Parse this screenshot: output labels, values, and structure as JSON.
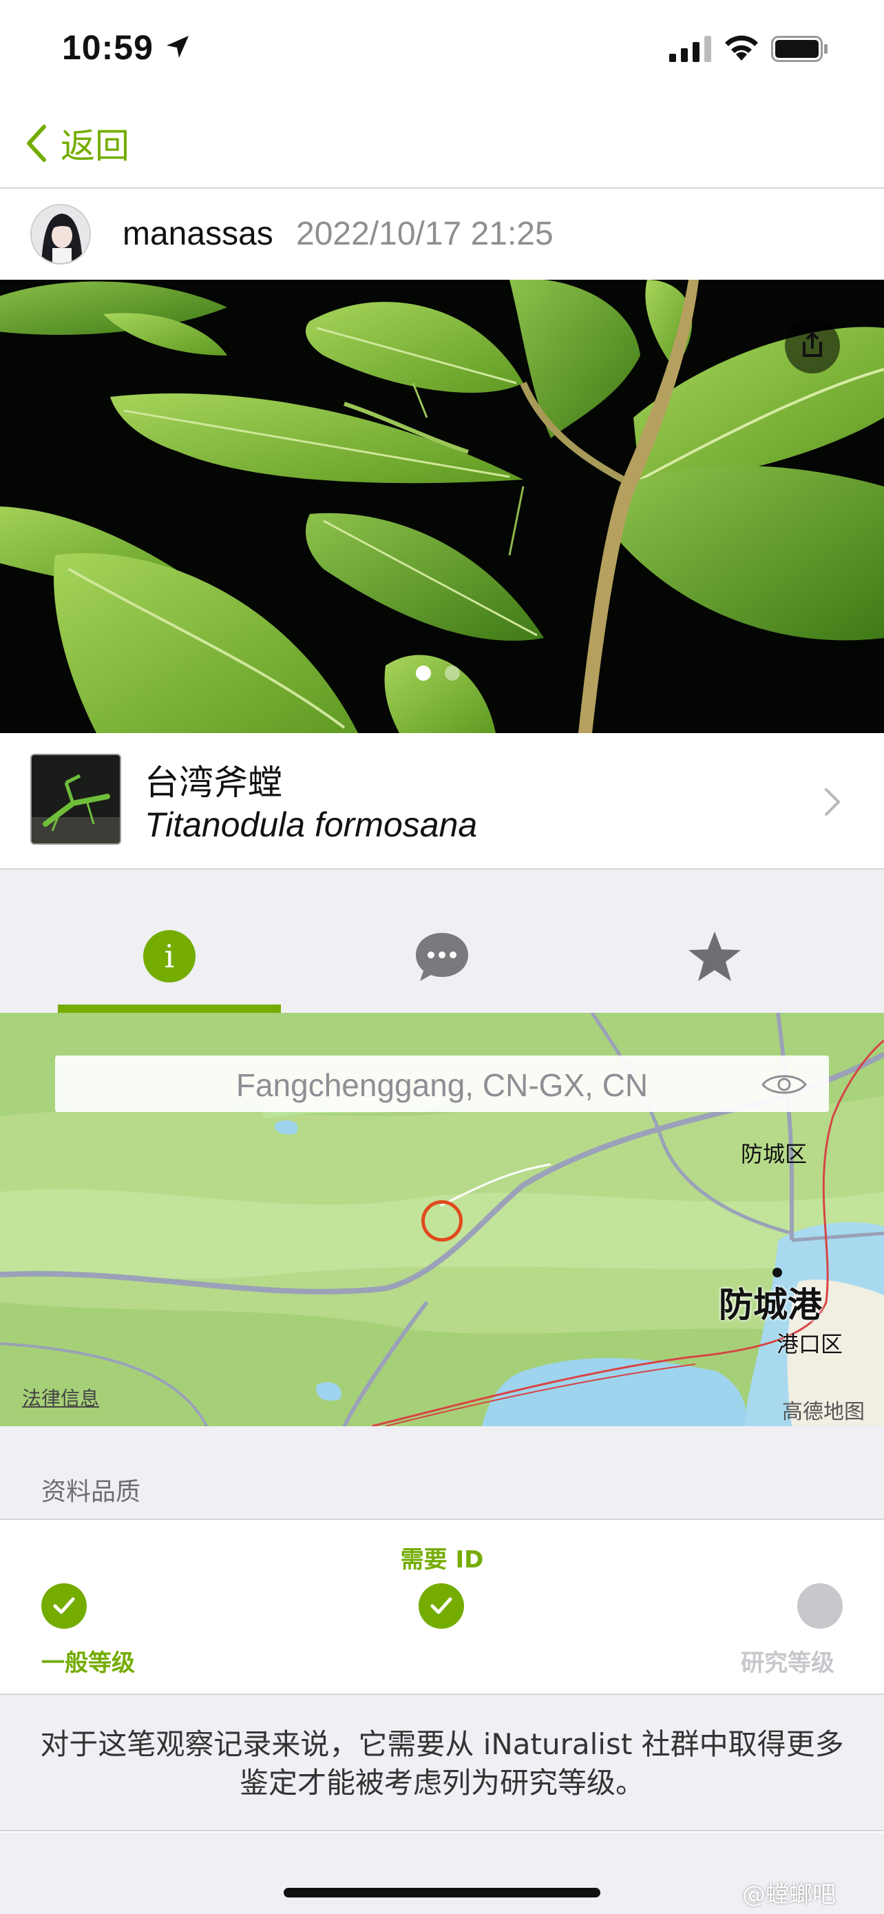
{
  "status_bar": {
    "time": "10:59"
  },
  "nav": {
    "back_label": "返回"
  },
  "observation": {
    "username": "manassas",
    "date": "2022/10/17 21:25",
    "photo_count": 2,
    "photo_index": 1
  },
  "taxon": {
    "common_name": "台湾斧螳",
    "scientific_name": "Titanodula formosana"
  },
  "tabs": [
    {
      "icon": "info-icon",
      "active": true
    },
    {
      "icon": "comment-icon",
      "active": false
    },
    {
      "icon": "star-icon",
      "active": false
    }
  ],
  "map": {
    "place_guess": "Fangchenggang, CN-GX, CN",
    "labels": {
      "district_north": "防城区",
      "city": "防城港",
      "district_south": "港口区"
    },
    "legal_link": "法律信息",
    "provider": "高德地图"
  },
  "data_quality": {
    "title": "资料品质",
    "needs_id_label": "需要 ID",
    "casual_label": "一般等级",
    "research_label": "研究等级",
    "description": "对于这笔观察记录来说，它需要从 iNaturalist 社群中取得更多鉴定才能被考虑列为研究等级。"
  },
  "watermark": "@螳螂吧",
  "colors": {
    "accent": "#74ac00",
    "muted_gray": "#8e8e93",
    "inactive_circle": "#c7c7cc",
    "marker": "#e04a1c"
  }
}
